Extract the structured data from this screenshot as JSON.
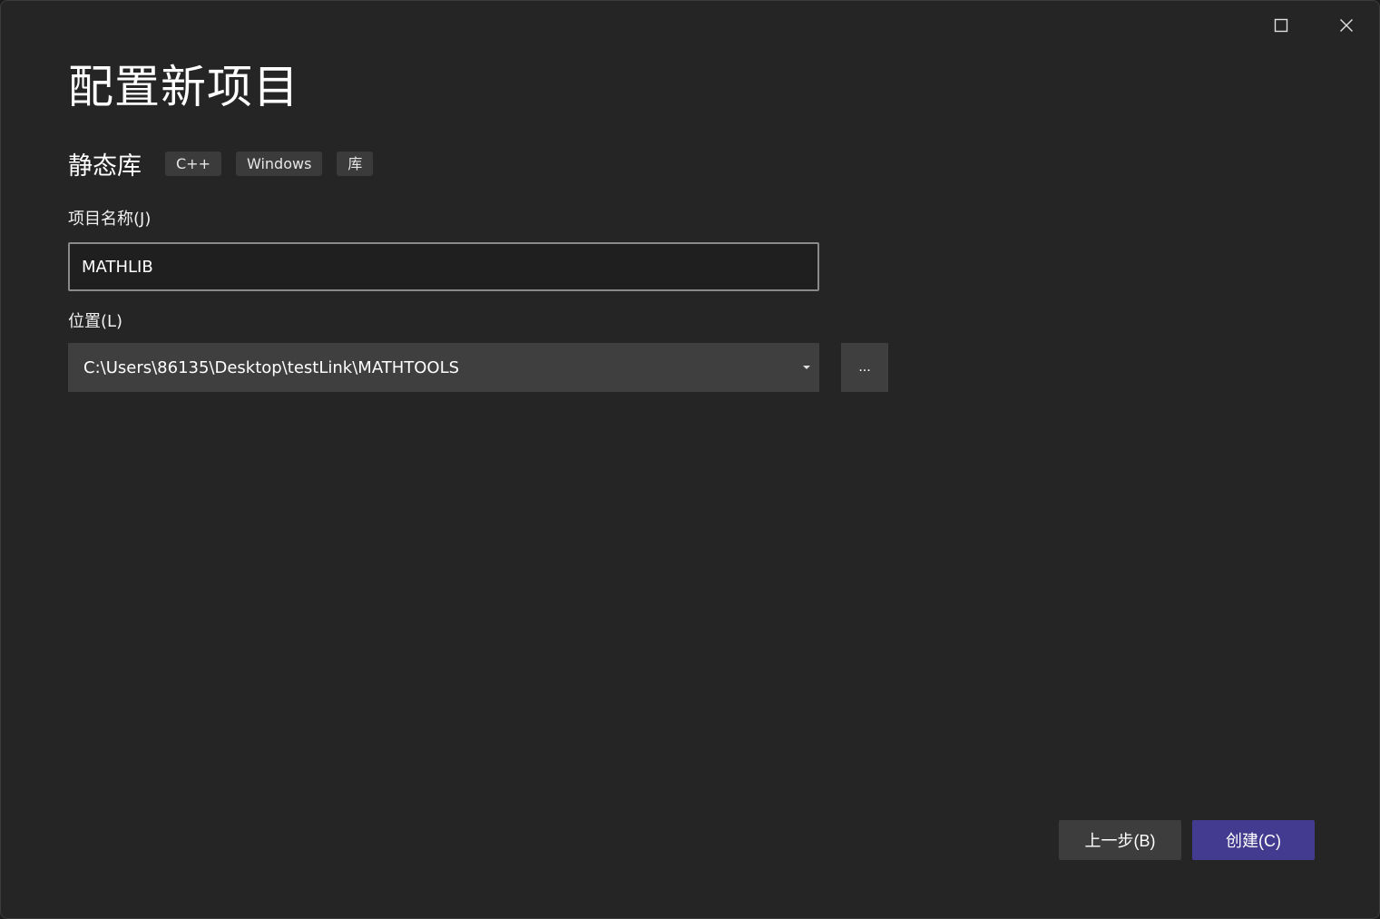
{
  "window": {
    "controls": {
      "maximize_icon": "maximize-icon",
      "close_icon": "close-icon"
    }
  },
  "header": {
    "title": "配置新项目"
  },
  "template": {
    "name": "静态库",
    "tags": [
      "C++",
      "Windows",
      "库"
    ]
  },
  "form": {
    "project_name_label": "项目名称(J)",
    "project_name_value": "MATHLIB",
    "location_label": "位置(L)",
    "location_value": "C:\\Users\\86135\\Desktop\\testLink\\MATHTOOLS",
    "browse_label": "..."
  },
  "footer": {
    "back_label": "上一步(B)",
    "create_label": "创建(C)"
  },
  "colors": {
    "background": "#252525",
    "input_background": "#1f1f1f",
    "select_background": "#3f3f3f",
    "primary_button": "#433b8f",
    "secondary_button": "#3d3d3d"
  }
}
